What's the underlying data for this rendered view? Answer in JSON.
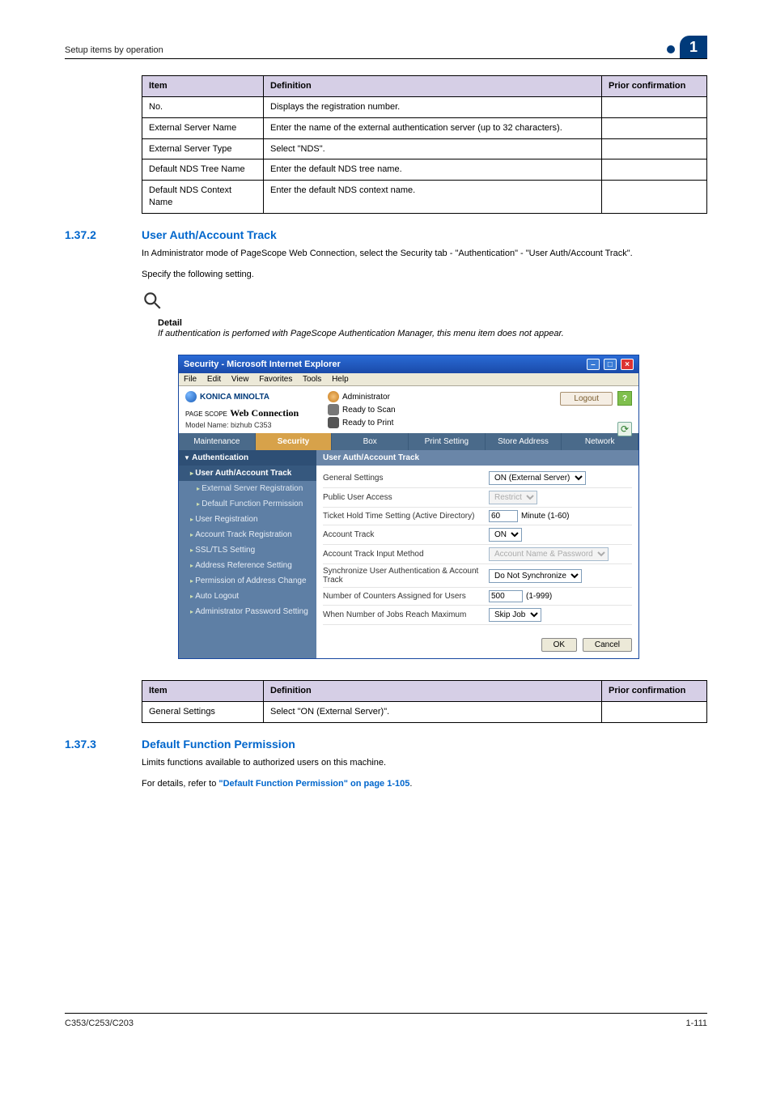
{
  "header": {
    "section_title": "Setup items by operation",
    "page_marker": "1"
  },
  "table1": {
    "headers": [
      "Item",
      "Definition",
      "Prior confirmation"
    ],
    "rows": [
      {
        "item": "No.",
        "def": "Displays the registration number.",
        "prior": ""
      },
      {
        "item": "External Server Name",
        "def": "Enter the name of the external authentication server (up to 32 characters).",
        "prior": ""
      },
      {
        "item": "External Server Type",
        "def": "Select \"NDS\".",
        "prior": ""
      },
      {
        "item": "Default NDS Tree Name",
        "def": "Enter the default NDS tree name.",
        "prior": ""
      },
      {
        "item": "Default NDS Context Name",
        "def": "Enter the default NDS context name.",
        "prior": ""
      }
    ]
  },
  "section2": {
    "num": "1.37.2",
    "title": "User Auth/Account Track",
    "para1": "In Administrator mode of PageScope Web Connection, select the Security tab - \"Authentication\" - \"User Auth/Account Track\".",
    "para2": "Specify the following setting.",
    "detail_label": "Detail",
    "detail_text": "If authentication is perfomed with PageScope Authentication Manager, this menu item does not appear."
  },
  "screenshot": {
    "window_title": "Security - Microsoft Internet Explorer",
    "menu": {
      "file": "File",
      "edit": "Edit",
      "view": "View",
      "favorites": "Favorites",
      "tools": "Tools",
      "help": "Help"
    },
    "brand": {
      "name": "KONICA MINOLTA",
      "product_a": "PAGE SCOPE",
      "product_b": "Web Connection",
      "model": "Model Name: bizhub C353"
    },
    "admin": {
      "role": "Administrator",
      "scan": "Ready to Scan",
      "print": "Ready to Print",
      "logout": "Logout"
    },
    "tabs": [
      "Maintenance",
      "Security",
      "Box",
      "Print Setting",
      "Store Address",
      "Network"
    ],
    "active_tab": 1,
    "sidebar": {
      "group": "Authentication",
      "items": [
        {
          "label": "User Auth/Account Track",
          "active": true,
          "sub": false
        },
        {
          "label": "External Server Registration",
          "active": false,
          "sub": true
        },
        {
          "label": "Default Function Permission",
          "active": false,
          "sub": true
        },
        {
          "label": "User Registration",
          "active": false,
          "sub": false
        },
        {
          "label": "Account Track Registration",
          "active": false,
          "sub": false
        },
        {
          "label": "SSL/TLS Setting",
          "active": false,
          "sub": false
        },
        {
          "label": "Address Reference Setting",
          "active": false,
          "sub": false
        },
        {
          "label": "Permission of Address Change",
          "active": false,
          "sub": false
        },
        {
          "label": "Auto Logout",
          "active": false,
          "sub": false
        },
        {
          "label": "Administrator Password Setting",
          "active": false,
          "sub": false
        }
      ]
    },
    "content": {
      "heading": "User Auth/Account Track",
      "rows": [
        {
          "label": "General Settings",
          "type": "select",
          "value": "ON (External Server)",
          "disabled": false
        },
        {
          "label": "Public User Access",
          "type": "select",
          "value": "Restrict",
          "disabled": true
        },
        {
          "label": "Ticket Hold Time Setting (Active Directory)",
          "type": "text",
          "value": "60",
          "suffix": "Minute (1-60)"
        },
        {
          "label": "Account Track",
          "type": "select",
          "value": "ON",
          "disabled": false
        },
        {
          "label": "Account Track Input Method",
          "type": "select",
          "value": "Account Name & Password",
          "disabled": true
        },
        {
          "label": "Synchronize User Authentication & Account Track",
          "type": "select",
          "value": "Do Not Synchronize",
          "disabled": false
        },
        {
          "label": "Number of Counters Assigned for Users",
          "type": "text",
          "value": "500",
          "suffix": "(1-999)"
        },
        {
          "label": "When Number of Jobs Reach Maximum",
          "type": "select",
          "value": "Skip Job",
          "disabled": false
        }
      ],
      "ok": "OK",
      "cancel": "Cancel"
    }
  },
  "table2": {
    "headers": [
      "Item",
      "Definition",
      "Prior confirmation"
    ],
    "rows": [
      {
        "item": "General Settings",
        "def": "Select \"ON (External Server)\".",
        "prior": ""
      }
    ]
  },
  "section3": {
    "num": "1.37.3",
    "title": "Default Function Permission",
    "para1": "Limits functions available to authorized users on this machine.",
    "para2_pre": "For details, refer to ",
    "para2_link": "\"Default Function Permission\" on page 1-105",
    "para2_post": "."
  },
  "footer": {
    "left": "C353/C253/C203",
    "right": "1-111"
  }
}
